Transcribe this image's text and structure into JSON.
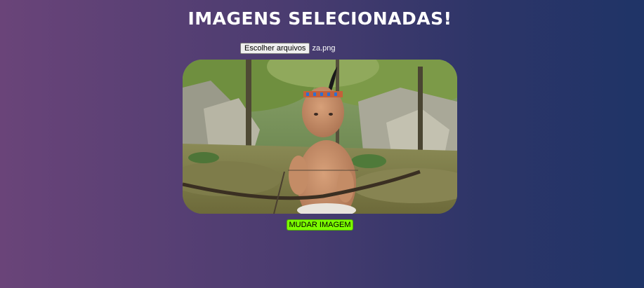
{
  "page": {
    "title": "IMAGENS SELECIONADAS!"
  },
  "file_input": {
    "button_label": "Escolher arquivos",
    "file_name": "za.png"
  },
  "preview": {
    "subject": "3D-rendered baby with feather headband holding a bow in a jungle scene"
  },
  "actions": {
    "change_image_label": "MUDAR IMAGEM"
  },
  "colors": {
    "background_left": "#6a4479",
    "background_right": "#1f3467",
    "title_text": "#ffffff",
    "change_button_bg": "#7cfc00"
  }
}
